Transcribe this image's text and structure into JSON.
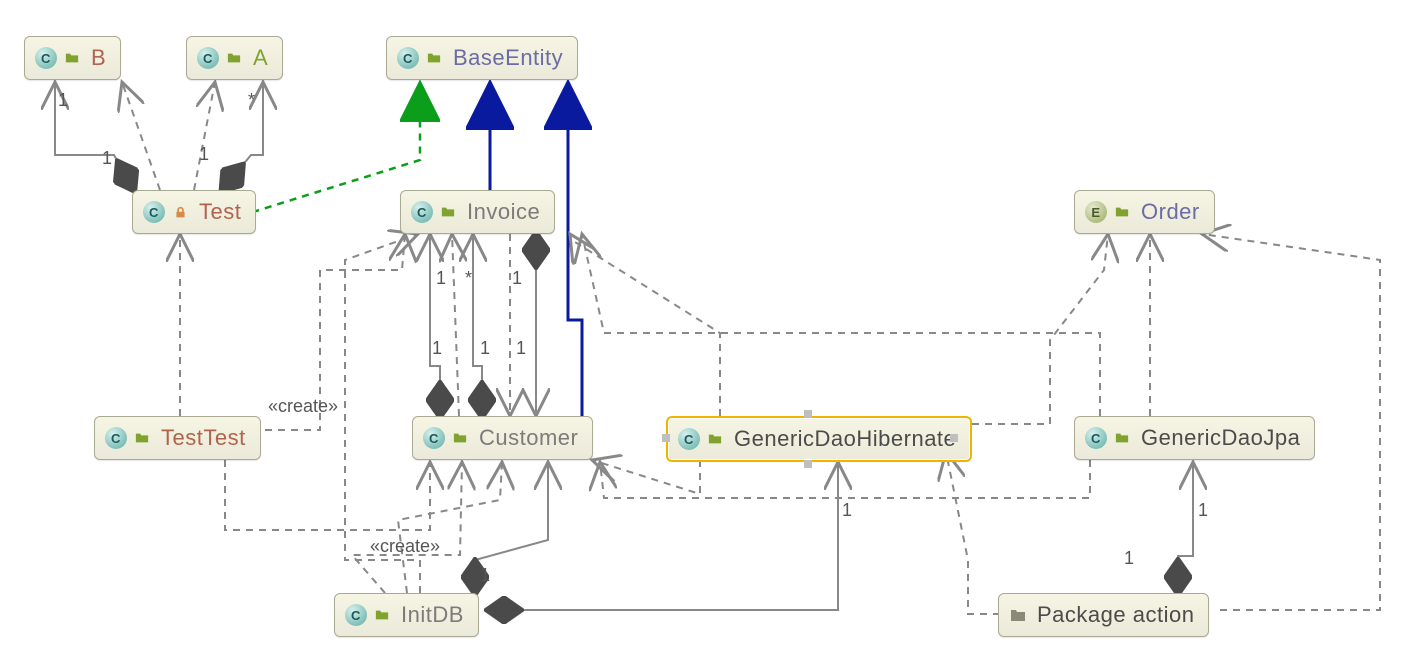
{
  "nodes": {
    "B": {
      "label": "B",
      "kind": "class",
      "vis": "package",
      "color": "red"
    },
    "A": {
      "label": "A",
      "kind": "class",
      "vis": "package",
      "color": "green"
    },
    "BaseEntity": {
      "label": "BaseEntity",
      "kind": "class",
      "vis": "package",
      "color": "purple"
    },
    "Test": {
      "label": "Test",
      "kind": "class",
      "vis": "private",
      "color": "red"
    },
    "Invoice": {
      "label": "Invoice",
      "kind": "class",
      "vis": "package",
      "color": "gray"
    },
    "Order": {
      "label": "Order",
      "kind": "enum",
      "vis": "package",
      "color": "purple"
    },
    "TestTest": {
      "label": "TestTest",
      "kind": "class",
      "vis": "package",
      "color": "red"
    },
    "Customer": {
      "label": "Customer",
      "kind": "class",
      "vis": "package",
      "color": "gray"
    },
    "GenericDaoHibernate": {
      "label": "GenericDaoHibernate",
      "kind": "class",
      "vis": "package",
      "color": "dark",
      "selected": true
    },
    "GenericDaoJpa": {
      "label": "GenericDaoJpa",
      "kind": "class",
      "vis": "package",
      "color": "dark"
    },
    "InitDB": {
      "label": "InitDB",
      "kind": "class",
      "vis": "package",
      "color": "gray"
    },
    "PackageAction": {
      "label": "Package action",
      "kind": "package",
      "color": "dark"
    }
  },
  "edges": [
    {
      "from": "Test",
      "to": "B",
      "type": "composition",
      "src_mult": "1",
      "dst_mult": "1"
    },
    {
      "from": "Test",
      "to": "B",
      "type": "dependency"
    },
    {
      "from": "Test",
      "to": "A",
      "type": "composition",
      "src_mult": "1",
      "dst_mult": "*"
    },
    {
      "from": "Test",
      "to": "A",
      "type": "dependency"
    },
    {
      "from": "Test",
      "to": "BaseEntity",
      "type": "realization"
    },
    {
      "from": "TestTest",
      "to": "Test",
      "type": "dependency"
    },
    {
      "from": "TestTest",
      "to": "Invoice",
      "type": "dependency",
      "stereotype": "«create»"
    },
    {
      "from": "TestTest",
      "to": "Customer",
      "type": "dependency"
    },
    {
      "from": "Invoice",
      "to": "BaseEntity",
      "type": "generalization"
    },
    {
      "from": "Customer",
      "to": "BaseEntity",
      "type": "generalization"
    },
    {
      "from": "Customer",
      "to": "Invoice",
      "type": "composition",
      "src_mult": "1",
      "dst_mult": "1"
    },
    {
      "from": "Customer",
      "to": "Invoice",
      "type": "composition",
      "src_mult": "1",
      "dst_mult": "*"
    },
    {
      "from": "Customer",
      "to": "Invoice",
      "type": "dependency"
    },
    {
      "from": "Invoice",
      "to": "Customer",
      "type": "composition",
      "src_mult": "1",
      "dst_mult": "1"
    },
    {
      "from": "Invoice",
      "to": "Customer",
      "type": "dependency"
    },
    {
      "from": "InitDB",
      "to": "Customer",
      "type": "dependency",
      "stereotype": "«create»"
    },
    {
      "from": "InitDB",
      "to": "Customer",
      "type": "dependency"
    },
    {
      "from": "InitDB",
      "to": "Customer",
      "type": "composition",
      "dst_mult": "1"
    },
    {
      "from": "InitDB",
      "to": "Invoice",
      "type": "dependency"
    },
    {
      "from": "InitDB",
      "to": "GenericDaoHibernate",
      "type": "composition",
      "dst_mult": "1"
    },
    {
      "from": "GenericDaoHibernate",
      "to": "Customer",
      "type": "dependency"
    },
    {
      "from": "GenericDaoHibernate",
      "to": "Invoice",
      "type": "dependency"
    },
    {
      "from": "GenericDaoHibernate",
      "to": "Order",
      "type": "dependency"
    },
    {
      "from": "GenericDaoJpa",
      "to": "Customer",
      "type": "dependency"
    },
    {
      "from": "GenericDaoJpa",
      "to": "Invoice",
      "type": "dependency"
    },
    {
      "from": "GenericDaoJpa",
      "to": "Order",
      "type": "dependency"
    },
    {
      "from": "PackageAction",
      "to": "GenericDaoJpa",
      "type": "composition",
      "src_mult": "1",
      "dst_mult": "1"
    },
    {
      "from": "PackageAction",
      "to": "GenericDaoHibernate",
      "type": "dependency"
    },
    {
      "from": "PackageAction",
      "to": "Order",
      "type": "dependency"
    }
  ],
  "labels": {
    "l1": "1",
    "l2": "1",
    "l3": "1",
    "l4": "*",
    "l5": "1",
    "l6": "*",
    "l7": "1",
    "l8": "1",
    "l9": "1",
    "l10": "1",
    "l11": "1",
    "l12": "1",
    "l13": "1",
    "l14": "1",
    "create1": "«create»",
    "create2": "«create»"
  },
  "colors": {
    "node_bg_top": "#f6f5e4",
    "node_bg_bottom": "#ebeada",
    "node_border": "#a9a994",
    "selected_border": "#f0b400",
    "generalization": "#0a1a9e",
    "realization": "#0a9e1a",
    "connector": "#888888"
  }
}
